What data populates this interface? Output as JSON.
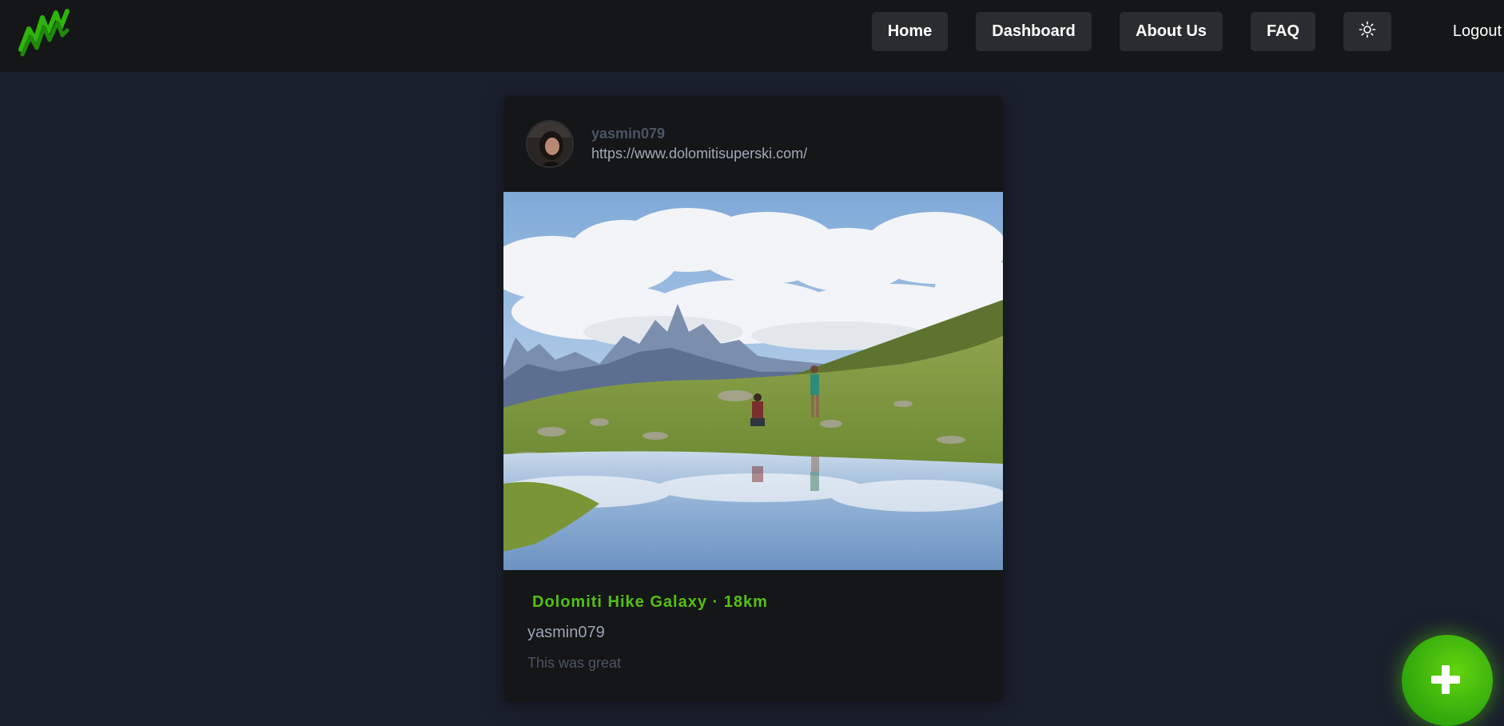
{
  "colors": {
    "page_background": "#1a1f2c",
    "navbar_background": "#141617",
    "card_background": "#141617",
    "nav_button_background": "#2a2c2e",
    "accent_green": "#55c014",
    "fab_green": "#3ab00d"
  },
  "navbar": {
    "logo_icon": "mountain-logo-icon",
    "items": [
      {
        "label": "Home"
      },
      {
        "label": "Dashboard"
      },
      {
        "label": "About Us"
      },
      {
        "label": "FAQ"
      }
    ],
    "theme_toggle_icon": "sun-icon",
    "logout_label": "Logout"
  },
  "post": {
    "author": {
      "username": "yasmin079",
      "link": "https://www.dolomitisuperski.com/"
    },
    "image_subject": "mountain-lake-landscape",
    "title": "Dolomiti Hike Galaxy · 18km",
    "username": "yasmin079",
    "description": "This was great"
  },
  "fab": {
    "icon": "plus-icon"
  }
}
